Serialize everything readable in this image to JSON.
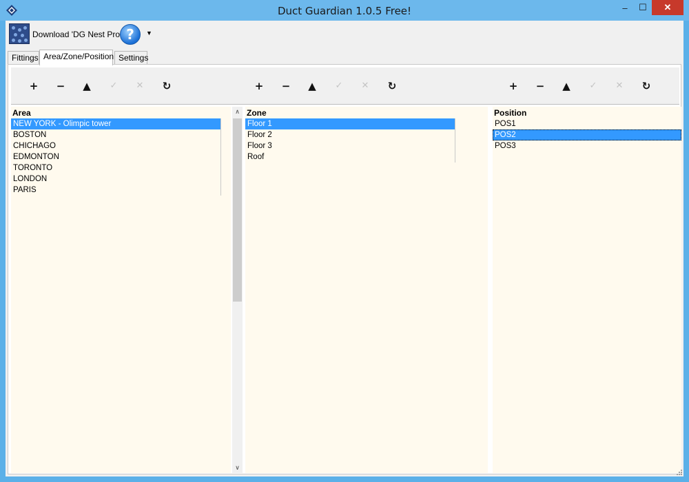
{
  "window": {
    "title": "Duct Guardian 1.0.5  Free!",
    "controls": {
      "minimize": "–",
      "maximize": "☐",
      "close": "✕"
    }
  },
  "toolbar": {
    "download_label": "Download 'DG Nest Pro'",
    "help_glyph": "?",
    "dropdown_glyph": "▼"
  },
  "tabs": [
    {
      "label": "Fittings",
      "active": false
    },
    {
      "label": "Area/Zone/Position",
      "active": true
    },
    {
      "label": "Settings",
      "active": false
    }
  ],
  "actions": {
    "glyphs": {
      "add": "+",
      "remove": "−",
      "move_up": "▲",
      "confirm": "✓",
      "cancel": "✕",
      "refresh": "↻"
    },
    "icons": [
      "plus-icon",
      "minus-icon",
      "move-up-icon",
      "check-icon",
      "cancel-icon",
      "refresh-icon"
    ],
    "enabled": [
      true,
      true,
      true,
      false,
      false,
      true
    ]
  },
  "area": {
    "header": "Area",
    "items": [
      "NEW YORK - Olimpic tower",
      "BOSTON",
      "CHICHAGO",
      "EDMONTON",
      "TORONTO",
      "LONDON",
      "PARIS"
    ],
    "selected_index": 0
  },
  "scrollbar": {
    "up": "∧",
    "down": "∨"
  },
  "zone": {
    "header": "Zone",
    "items": [
      "Floor 1",
      "Floor 2",
      "Floor 3",
      "Roof"
    ],
    "selected_index": 0
  },
  "position": {
    "header": "Position",
    "items": [
      "POS1",
      "POS2",
      "POS3"
    ],
    "selected_index": 1
  },
  "colors": {
    "selection": "#3399ff",
    "list_background": "#fffaee",
    "titlebar": "#6cb8ec",
    "close_button": "#c7392b"
  }
}
